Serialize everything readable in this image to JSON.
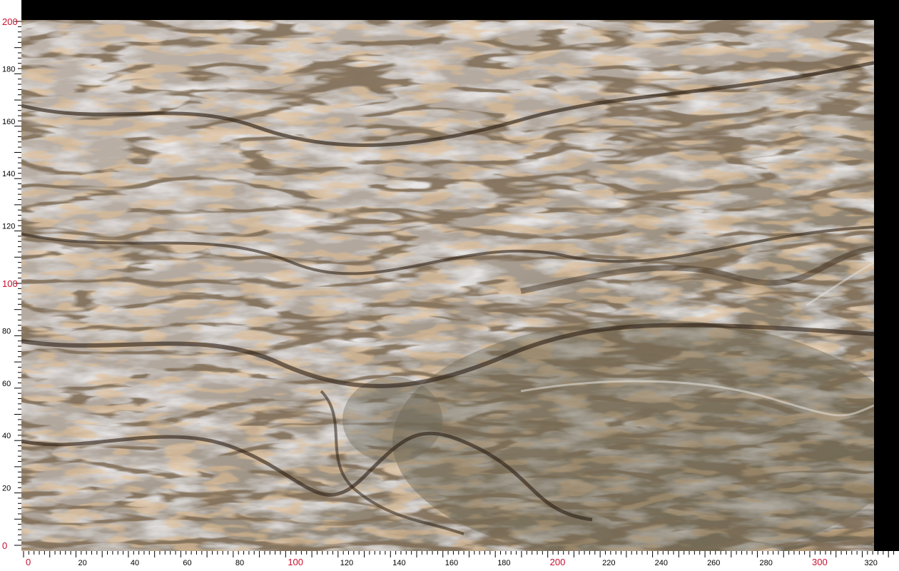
{
  "image": {
    "subject": "marble-slab",
    "colors": {
      "base": "#a69a8c",
      "light": "#d6d2d3",
      "veining": "#3b2a1c",
      "rust": "#c2874a",
      "olive": "#7a6e58",
      "background": "#000000",
      "ruler": "#ffffff",
      "major_label": "#c8102e"
    }
  },
  "rulers": {
    "vertical_labels": [
      "0",
      "20",
      "40",
      "60",
      "80",
      "100",
      "120",
      "140",
      "160",
      "180",
      "200"
    ],
    "vertical_major": [
      "0",
      "100",
      "200"
    ],
    "horizontal_labels": [
      "0",
      "20",
      "40",
      "60",
      "80",
      "100",
      "120",
      "140",
      "160",
      "180",
      "200",
      "220",
      "240",
      "260",
      "280",
      "300",
      "320"
    ],
    "horizontal_major": [
      "0",
      "100",
      "200",
      "300"
    ]
  }
}
